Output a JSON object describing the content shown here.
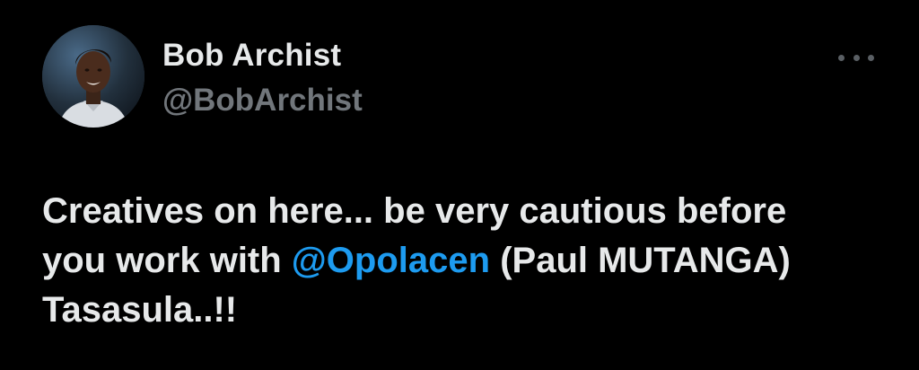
{
  "author": {
    "display_name": "Bob Archist",
    "handle": "@BobArchist"
  },
  "icons": {
    "more": "more-horizontal-icon"
  },
  "tweet": {
    "line1": "Creatives on here... be very cautious before",
    "line2_prefix": "you work with ",
    "mention": "@Opolacen",
    "line2_suffix": " (Paul MUTANGA)",
    "line3": "Tasasula..!!"
  },
  "colors": {
    "background": "#000000",
    "text": "#e7e9ea",
    "secondary_text": "#71767b",
    "link": "#1d9bf0"
  }
}
